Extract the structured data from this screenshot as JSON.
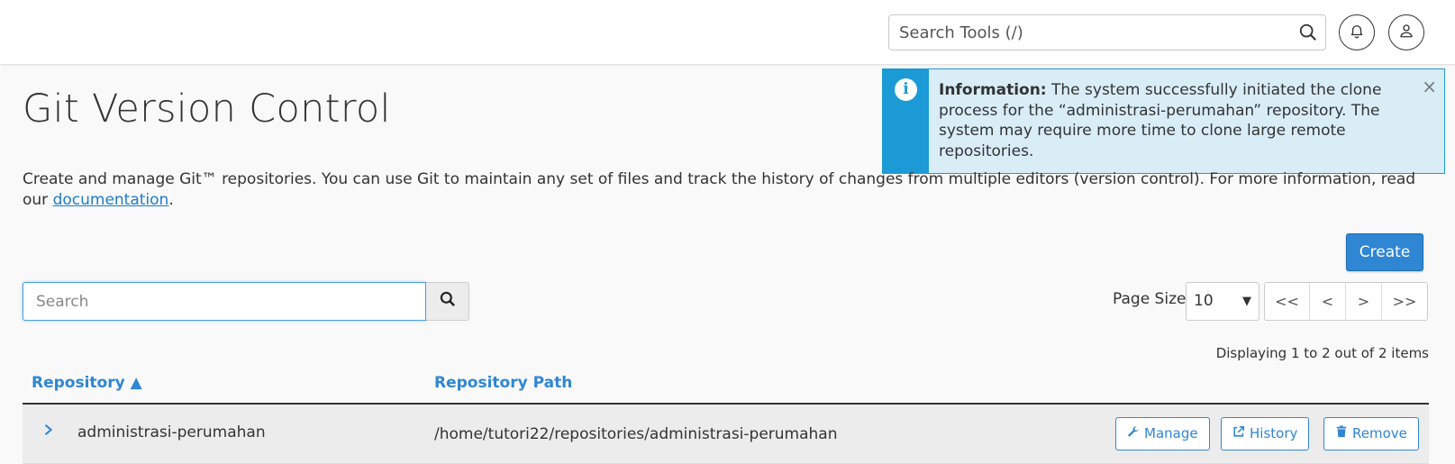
{
  "header": {
    "search_placeholder": "Search Tools (/)"
  },
  "notice": {
    "label": "Information:",
    "text": " The system successfully initiated the clone process for the “administrasi-perumahan” repository. The system may require more time to clone large remote repositories.",
    "close": "×"
  },
  "page": {
    "title": "Git Version Control",
    "description": "Create and manage Git™ repositories. You can use Git to maintain any set of files and track the history of changes from multiple editors (version control). For more information, read our ",
    "doc_link": "documentation",
    "desc_end": "."
  },
  "toolbar": {
    "create_label": "Create",
    "search_placeholder": "Search",
    "page_size_label": "Page Size",
    "page_size_value": "10",
    "pager": [
      "<<",
      "<",
      ">",
      ">>"
    ],
    "displaying": "Displaying 1 to 2 out of 2 items"
  },
  "table": {
    "col_repo": "Repository ▲",
    "col_path": "Repository Path",
    "rows": [
      {
        "name": "administrasi-perumahan",
        "path": "/home/tutori22/repositories/administrasi-perumahan",
        "manage": "Manage",
        "history": "History",
        "remove": "Remove"
      }
    ]
  },
  "colors": {
    "accent": "#2f86d2",
    "info": "#1b9ad6",
    "info_bg": "#d9edf7"
  }
}
